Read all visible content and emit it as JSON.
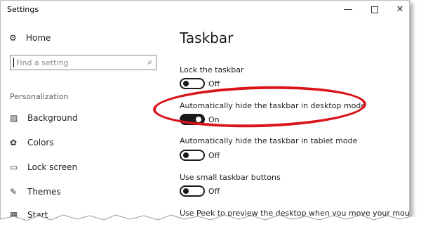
{
  "window": {
    "title": "Settings"
  },
  "controls": {
    "minimize": "—",
    "close": "✕"
  },
  "sidebar": {
    "home_label": "Home",
    "search_placeholder": "Find a setting",
    "section_title": "Personalization",
    "items": [
      {
        "label": "Background",
        "icon": "picture-icon"
      },
      {
        "label": "Colors",
        "icon": "palette-icon"
      },
      {
        "label": "Lock screen",
        "icon": "lock-screen-icon"
      },
      {
        "label": "Themes",
        "icon": "themes-icon"
      },
      {
        "label": "Start",
        "icon": "start-icon"
      }
    ]
  },
  "main": {
    "title": "Taskbar",
    "settings": [
      {
        "label": "Lock the taskbar",
        "state": "Off",
        "on": false
      },
      {
        "label": "Automatically hide the taskbar in desktop mode",
        "state": "On",
        "on": true
      },
      {
        "label": "Automatically hide the taskbar in tablet mode",
        "state": "Off",
        "on": false
      },
      {
        "label": "Use small taskbar buttons",
        "state": "Off",
        "on": false
      },
      {
        "label": "Use Peek to preview the desktop when you move your mouse to"
      }
    ]
  },
  "colors": {
    "accent_oval": "#d9141a",
    "toggle_on": "#1a1a1a"
  }
}
